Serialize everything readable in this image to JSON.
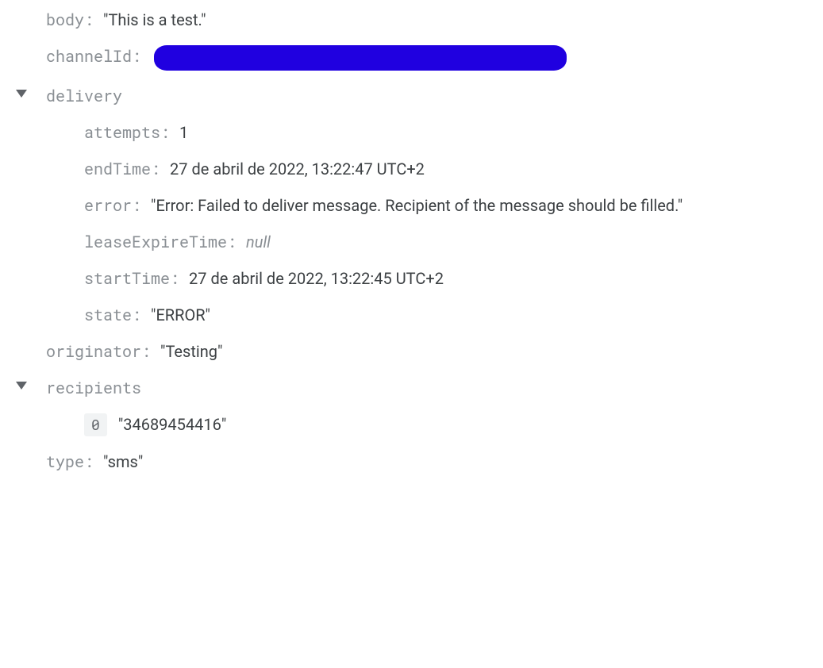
{
  "fields": {
    "body_key": "body",
    "body_value": "\"This is a test.\"",
    "channelId_key": "channelId",
    "delivery_key": "delivery",
    "attempts_key": "attempts",
    "attempts_value": "1",
    "endTime_key": "endTime",
    "endTime_value": "27 de abril de 2022, 13:22:47 UTC+2",
    "error_key": "error",
    "error_value": "\"Error: Failed to deliver message. Recipient of the message should be filled.\"",
    "leaseExpireTime_key": "leaseExpireTime",
    "leaseExpireTime_value": "null",
    "startTime_key": "startTime",
    "startTime_value": "27 de abril de 2022, 13:22:45 UTC+2",
    "state_key": "state",
    "state_value": "\"ERROR\"",
    "originator_key": "originator",
    "originator_value": "\"Testing\"",
    "recipients_key": "recipients",
    "recipients_index0": "0",
    "recipients_value0": "\"34689454416\"",
    "type_key": "type",
    "type_value": "\"sms\""
  }
}
